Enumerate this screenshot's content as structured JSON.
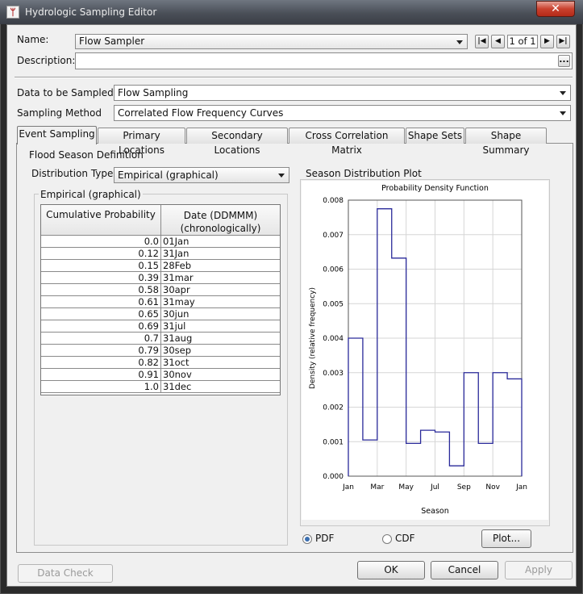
{
  "window": {
    "title": "Hydrologic Sampling Editor",
    "close_glyph": "✕"
  },
  "header": {
    "name_label": "Name:",
    "name_value": "Flow Sampler",
    "record_counter": "1 of 1",
    "description_label": "Description:",
    "description_value": "",
    "description_button": "..."
  },
  "settings": {
    "data_label": "Data to be Sampled",
    "data_value": "Flow Sampling",
    "method_label": "Sampling Method",
    "method_value": "Correlated Flow Frequency Curves"
  },
  "tabs": [
    {
      "label": "Event Sampling",
      "active": true
    },
    {
      "label": "Primary Locations"
    },
    {
      "label": "Secondary Locations"
    },
    {
      "label": "Cross Correlation Matrix"
    },
    {
      "label": "Shape Sets"
    },
    {
      "label": "Shape Summary"
    }
  ],
  "flood_season": {
    "group_label": "Flood Season Definition",
    "dist_type_label": "Distribution Type",
    "dist_type_value": "Empirical (graphical)",
    "empirical_label": "Empirical (graphical)",
    "columns": [
      "Cumulative Probability",
      "Date (DDMMM)",
      "(chronologically)"
    ],
    "rows": [
      {
        "prob": "0.0",
        "date": "01Jan"
      },
      {
        "prob": "0.12",
        "date": "31Jan"
      },
      {
        "prob": "0.15",
        "date": "28Feb"
      },
      {
        "prob": "0.39",
        "date": "31mar"
      },
      {
        "prob": "0.58",
        "date": "30apr"
      },
      {
        "prob": "0.61",
        "date": "31may"
      },
      {
        "prob": "0.65",
        "date": "30jun"
      },
      {
        "prob": "0.69",
        "date": "31jul"
      },
      {
        "prob": "0.7",
        "date": "31aug"
      },
      {
        "prob": "0.79",
        "date": "30sep"
      },
      {
        "prob": "0.82",
        "date": "31oct"
      },
      {
        "prob": "0.91",
        "date": "30nov"
      },
      {
        "prob": "1.0",
        "date": "31dec"
      }
    ]
  },
  "plot_panel": {
    "group_label": "Season Distribution Plot",
    "pdf_label": "PDF",
    "cdf_label": "CDF",
    "pdf_selected": true,
    "plot_button": "Plot..."
  },
  "chart_data": {
    "type": "line",
    "title": "Probability Density Function",
    "xlabel": "Season",
    "ylabel": "Density (relative frequency)",
    "ylim": [
      0,
      0.008
    ],
    "yticks": [
      "0.000",
      "0.001",
      "0.002",
      "0.003",
      "0.004",
      "0.005",
      "0.006",
      "0.007",
      "0.008"
    ],
    "xticks": [
      "Jan",
      "Mar",
      "May",
      "Jul",
      "Sep",
      "Nov",
      "Jan"
    ],
    "grid": true,
    "step_series": {
      "color": "#2a2a9a",
      "steps": [
        {
          "x0": 0,
          "x1": 0.5,
          "y": 0.004
        },
        {
          "x0": 0.5,
          "x1": 1.0,
          "y": 0.00105
        },
        {
          "x0": 1.0,
          "x1": 1.5,
          "y": 0.00775
        },
        {
          "x0": 1.5,
          "x1": 2.0,
          "y": 0.00632
        },
        {
          "x0": 2.0,
          "x1": 2.5,
          "y": 0.00095
        },
        {
          "x0": 2.5,
          "x1": 3.0,
          "y": 0.00133
        },
        {
          "x0": 3.0,
          "x1": 3.5,
          "y": 0.00128
        },
        {
          "x0": 3.5,
          "x1": 4.0,
          "y": 0.0003
        },
        {
          "x0": 4.0,
          "x1": 4.5,
          "y": 0.003
        },
        {
          "x0": 4.5,
          "x1": 5.0,
          "y": 0.00095
        },
        {
          "x0": 5.0,
          "x1": 5.5,
          "y": 0.003
        },
        {
          "x0": 5.5,
          "x1": 6.0,
          "y": 0.00282
        }
      ]
    }
  },
  "footer": {
    "data_check": "Data Check",
    "ok": "OK",
    "cancel": "Cancel",
    "apply": "Apply"
  }
}
